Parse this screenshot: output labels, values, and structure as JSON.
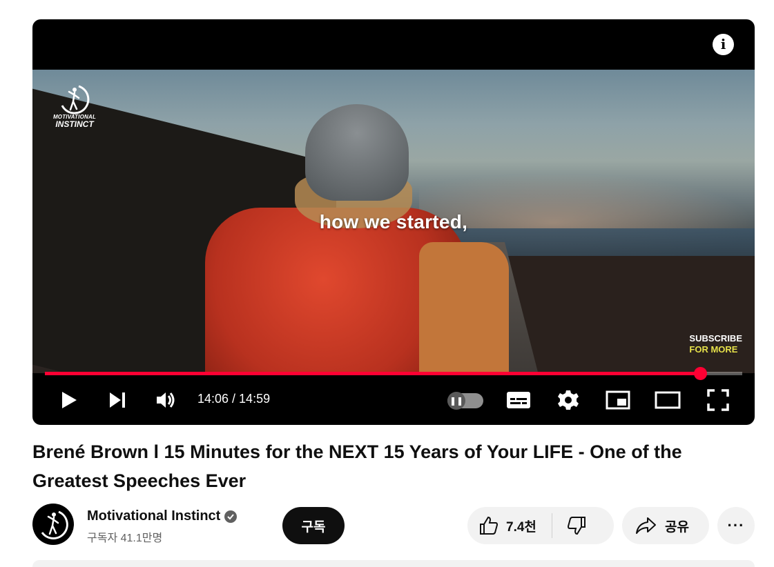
{
  "player": {
    "caption": "how we started,",
    "watermark_logo_line1": "MOTIVATIONAL",
    "watermark_logo_line2": "INSTINCT",
    "subscribe_line1": "SUBSCRIBE",
    "subscribe_line2": "FOR MORE",
    "info_glyph": "i",
    "time_display": "14:06 / 14:59",
    "current_time": "14:06",
    "duration": "14:59",
    "progress_fraction": 0.94,
    "progress_color": "#ff0033",
    "icons": [
      "play-icon",
      "next-icon",
      "volume-icon",
      "autoplay-toggle",
      "subtitles-icon",
      "settings-icon",
      "miniplayer-icon",
      "theater-icon",
      "fullscreen-icon"
    ]
  },
  "video": {
    "title": "Brené Brown l 15 Minutes for the NEXT 15 Years of Your LIFE - One of the Greatest Speeches Ever"
  },
  "channel": {
    "name": "Motivational Instinct",
    "subscribers": "구독자 41.1만명",
    "subscribe_label": "구독",
    "verified": true
  },
  "actions": {
    "like_count": "7.4천",
    "share_label": "공유",
    "more_label": "···"
  }
}
